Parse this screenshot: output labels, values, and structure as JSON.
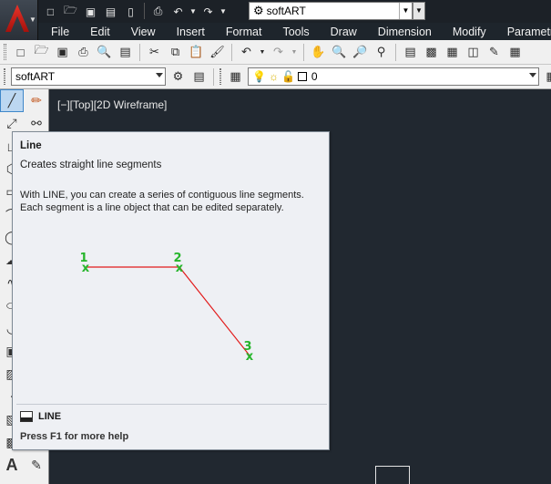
{
  "quick_access": {
    "workspace": "softART"
  },
  "menubar": {
    "items": [
      "File",
      "Edit",
      "View",
      "Insert",
      "Format",
      "Tools",
      "Draw",
      "Dimension",
      "Modify",
      "Parametric"
    ]
  },
  "toolbar_properties": {
    "style_combo": "softART",
    "layer_value": "0"
  },
  "viewport": {
    "label": "[−][Top][2D Wireframe]"
  },
  "tooltip": {
    "title": "Line",
    "subtitle": "Creates straight line segments",
    "description_line1": "With LINE, you can create a series of contiguous line segments.",
    "description_line2": "Each segment is a line object that can be edited separately.",
    "figure": {
      "point_labels": [
        "1",
        "2",
        "3"
      ],
      "marker": "x",
      "line_color": "#e21b1b",
      "point_color": "#26b52b"
    },
    "command": "LINE",
    "help_hint": "Press F1 for more help"
  },
  "colors": {
    "canvas_bg": "#212830",
    "title_bar": "#1c2127",
    "toolbar_bg": "#f0f0f0",
    "tooltip_bg": "#eef0f4",
    "active_tool": "#bcd7f1"
  }
}
